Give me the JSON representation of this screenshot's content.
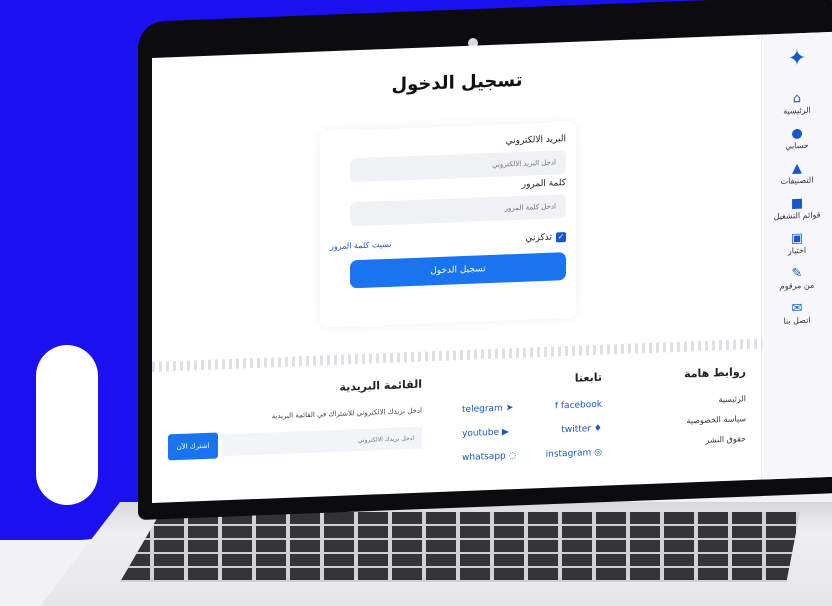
{
  "colors": {
    "background": "#1a10f0",
    "accent": "#1a74f0",
    "link": "#1657c9"
  },
  "sidebar": {
    "logo_icon": "stars-logo-icon",
    "items": [
      {
        "icon": "home-icon",
        "label": "الرئيسية"
      },
      {
        "icon": "user-icon",
        "label": "حسابي"
      },
      {
        "icon": "categories-icon",
        "label": "التصنيفات"
      },
      {
        "icon": "briefcase-icon",
        "label": "قوائم التشغيل"
      },
      {
        "icon": "quiz-icon",
        "label": "اختبار"
      },
      {
        "icon": "pen-icon",
        "label": "من مرقوم"
      },
      {
        "icon": "mail-icon",
        "label": "اتصل بنا"
      }
    ]
  },
  "login": {
    "title": "تسجيل الدخول",
    "email_label": "البريد الالكتروني",
    "email_placeholder": "ادخل البريد الالكتروني",
    "password_label": "كلمة المرور",
    "password_placeholder": "ادخل كلمة المرور",
    "remember_label": "تذكرني",
    "forgot_link": "نسيت كلمة المرور",
    "submit_label": "تسجيل الدخول"
  },
  "footer": {
    "links_title": "روابط هامة",
    "links": [
      "الرئيسية",
      "سياسة الخصوصية",
      "حقوق النشر"
    ],
    "follow_title": "تابعنا",
    "social": [
      {
        "name": "facebook",
        "icon": "facebook-icon"
      },
      {
        "name": "telegram",
        "icon": "telegram-icon"
      },
      {
        "name": "twitter",
        "icon": "twitter-icon"
      },
      {
        "name": "youtube",
        "icon": "youtube-icon"
      },
      {
        "name": "instagram",
        "icon": "instagram-icon"
      },
      {
        "name": "whatsapp",
        "icon": "whatsapp-icon"
      }
    ],
    "newsletter_title": "القائمة البريدية",
    "newsletter_desc": "ادخل بريدك الالكتروني للاشتراك في القائمة البريدية",
    "newsletter_placeholder": "ادخل بريدك الالكتروني",
    "subscribe_label": "اشترك الآن"
  }
}
